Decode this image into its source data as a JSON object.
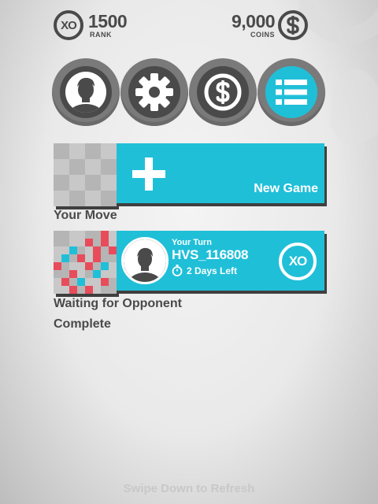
{
  "stats": {
    "rank": {
      "badge": "XO",
      "value": "1500",
      "label": "RANK"
    },
    "coins": {
      "value": "9,000",
      "label": "COINS"
    }
  },
  "menu": [
    {
      "id": "profile",
      "icon": "user-avatar-icon",
      "active": false
    },
    {
      "id": "settings",
      "icon": "gear-icon",
      "active": false
    },
    {
      "id": "store",
      "icon": "dollar-coin-icon",
      "active": false
    },
    {
      "id": "list",
      "icon": "list-icon",
      "active": true
    }
  ],
  "new_game": {
    "label": "New Game",
    "icon": "plus-icon"
  },
  "sections": {
    "your_move": "Your Move",
    "waiting": "Waiting for Opponent",
    "complete": "Complete"
  },
  "game": {
    "turn": "Your Turn",
    "opponent": "HVS_116808",
    "time_left": "2 Days Left",
    "badge": "XO"
  },
  "footer": {
    "hint": "Swipe Down to Refresh"
  },
  "colors": {
    "accent": "#20bfd8",
    "dark": "#4a4a4a",
    "board_red": "#e84c5b",
    "board_blue": "#20bfd8"
  }
}
